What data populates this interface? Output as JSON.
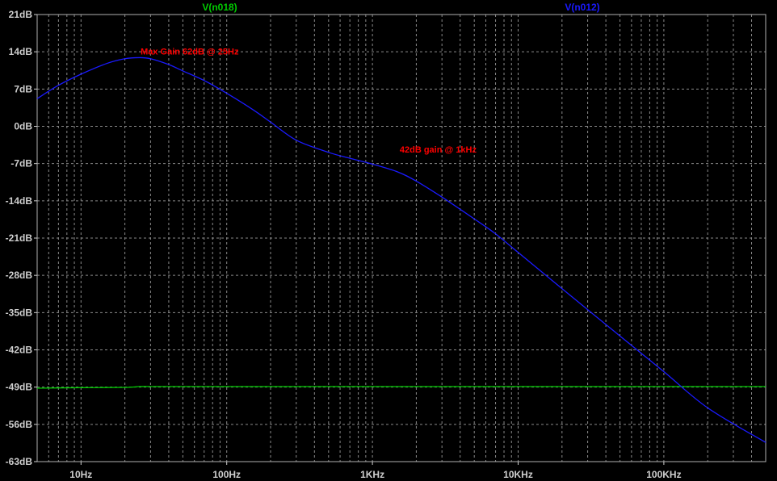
{
  "chart_data": {
    "type": "line",
    "title": "",
    "xlabel": "",
    "ylabel": "",
    "x_scale": "log",
    "xlim": [
      5,
      500000
    ],
    "ylim": [
      -63,
      21
    ],
    "grid": true,
    "x_major_ticks": [
      {
        "value": 10,
        "label": "10Hz"
      },
      {
        "value": 100,
        "label": "100Hz"
      },
      {
        "value": 1000,
        "label": "1KHz"
      },
      {
        "value": 10000,
        "label": "10KHz"
      },
      {
        "value": 100000,
        "label": "100KHz"
      }
    ],
    "y_ticks": [
      {
        "value": 21,
        "label": "21dB"
      },
      {
        "value": 14,
        "label": "14dB"
      },
      {
        "value": 7,
        "label": "7dB"
      },
      {
        "value": 0,
        "label": "0dB"
      },
      {
        "value": -7,
        "label": "-7dB"
      },
      {
        "value": -14,
        "label": "-14dB"
      },
      {
        "value": -21,
        "label": "-21dB"
      },
      {
        "value": -28,
        "label": "-28dB"
      },
      {
        "value": -35,
        "label": "-35dB"
      },
      {
        "value": -42,
        "label": "-42dB"
      },
      {
        "value": -49,
        "label": "-49dB"
      },
      {
        "value": -56,
        "label": "-56dB"
      },
      {
        "value": -63,
        "label": "-63dB"
      }
    ],
    "series": [
      {
        "name": "V(n018)",
        "color": "#00cc00",
        "x": [
          5,
          10,
          20,
          25,
          30,
          50,
          100,
          1000,
          10000,
          100000,
          500000
        ],
        "y": [
          -49.2,
          -49.1,
          -49.05,
          -48.9,
          -48.9,
          -48.9,
          -48.9,
          -48.9,
          -48.9,
          -48.9,
          -48.9
        ]
      },
      {
        "name": "V(n012)",
        "color": "#1a1aff",
        "x": [
          5,
          7,
          10,
          15,
          20,
          25,
          30,
          40,
          50,
          70,
          100,
          150,
          200,
          300,
          500,
          700,
          1000,
          1500,
          2000,
          3000,
          5000,
          7000,
          10000,
          20000,
          50000,
          100000,
          200000,
          500000
        ],
        "y": [
          5.2,
          7.7,
          9.8,
          11.8,
          12.7,
          12.9,
          12.7,
          11.6,
          10.4,
          8.6,
          6.2,
          3.2,
          0.8,
          -2.6,
          -4.9,
          -6.0,
          -7.1,
          -8.6,
          -10.3,
          -13.3,
          -17.4,
          -20.2,
          -23.7,
          -30.5,
          -39.4,
          -46.1,
          -52.9,
          -59.4
        ]
      }
    ],
    "annotations": [
      {
        "text": "Max Gain 62dB @ 25Hz",
        "x": 25,
        "y": 14.1,
        "color": "#ff0000"
      },
      {
        "text": "42dB gain @ 1kHz",
        "x": 1500,
        "y": -4.3,
        "color": "#ff0000"
      }
    ],
    "legend_placement": "top"
  }
}
